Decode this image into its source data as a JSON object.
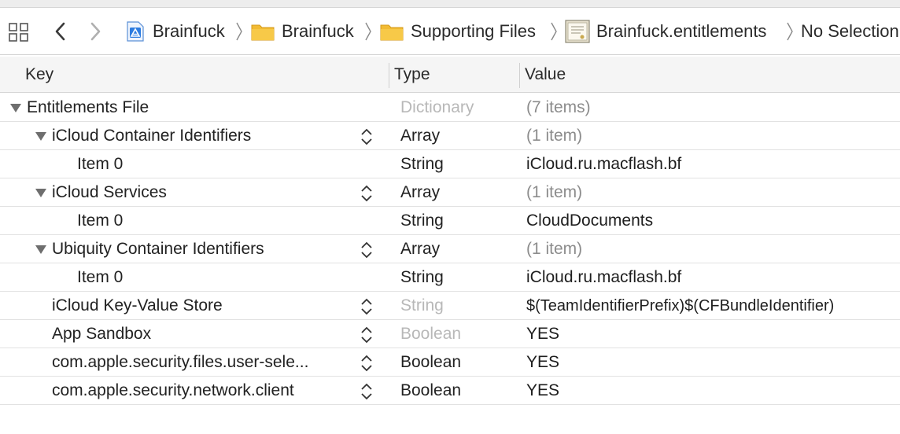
{
  "window": {
    "accent_color": "#1e6fd9"
  },
  "jumpbar": {
    "icons": {
      "grid": "related-items-grid-icon",
      "back": "chevron-left-icon",
      "forward": "chevron-right-icon"
    },
    "breadcrumb": [
      {
        "label": "Brainfuck",
        "icon": "xcode-project-icon"
      },
      {
        "label": "Brainfuck",
        "icon": "folder-icon"
      },
      {
        "label": "Supporting Files",
        "icon": "folder-icon"
      },
      {
        "label": "Brainfuck.entitlements",
        "icon": "entitlements-file-icon"
      },
      {
        "label": "No Selection",
        "icon": ""
      }
    ]
  },
  "table": {
    "columns": {
      "key": "Key",
      "type": "Type",
      "value": "Value"
    },
    "rows": [
      {
        "key": "Entitlements File",
        "type": "Dictionary",
        "value": "(7 items)",
        "level": 0,
        "expanded": true
      },
      {
        "key": "iCloud Container Identifiers",
        "type": "Array",
        "value": "(1 item)",
        "level": 1,
        "expanded": true
      },
      {
        "key": "Item 0",
        "type": "String",
        "value": "iCloud.ru.macflash.bf",
        "level": 2
      },
      {
        "key": "iCloud Services",
        "type": "Array",
        "value": "(1 item)",
        "level": 1,
        "expanded": true
      },
      {
        "key": "Item 0",
        "type": "String",
        "value": "CloudDocuments",
        "level": 2
      },
      {
        "key": "Ubiquity Container Identifiers",
        "type": "Array",
        "value": "(1 item)",
        "level": 1,
        "expanded": true
      },
      {
        "key": "Item 0",
        "type": "String",
        "value": "iCloud.ru.macflash.bf",
        "level": 2
      },
      {
        "key": "iCloud Key-Value Store",
        "type": "String",
        "value": "$(TeamIdentifierPrefix)$(CFBundleIdentifier)",
        "level": 1
      },
      {
        "key": "App Sandbox",
        "type": "Boolean",
        "value": "YES",
        "level": 1
      },
      {
        "key": "com.apple.security.files.user-sele...",
        "type": "Boolean",
        "value": "YES",
        "level": 1
      },
      {
        "key": "com.apple.security.network.client",
        "type": "Boolean",
        "value": "YES",
        "level": 1
      }
    ]
  }
}
